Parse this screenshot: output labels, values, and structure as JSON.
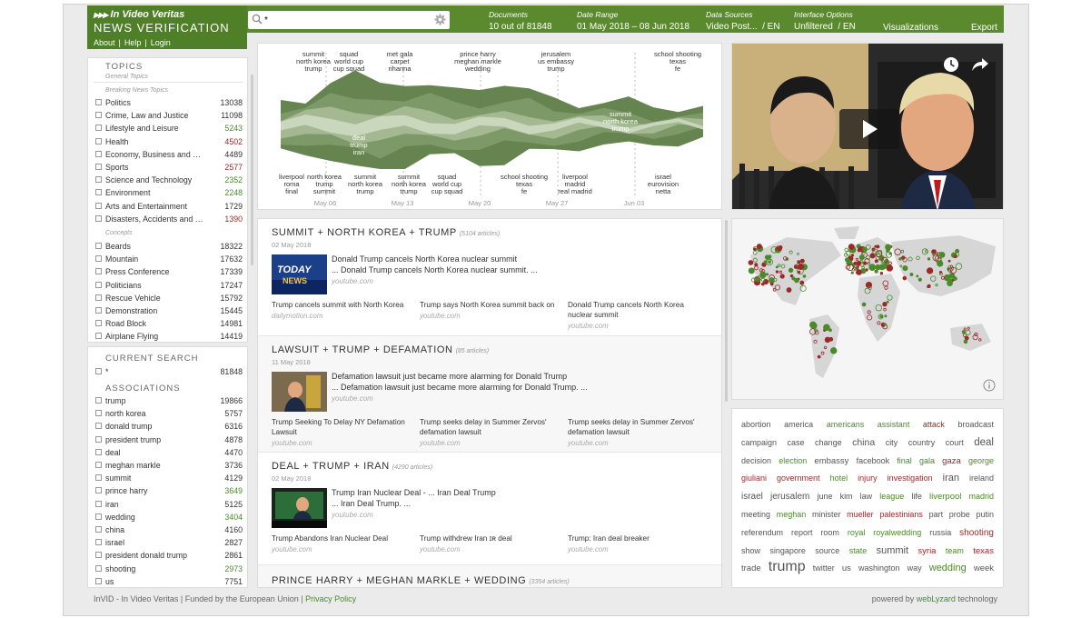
{
  "brand": {
    "line1": "In Video Veritas",
    "line2": "NEWS VERIFICATION",
    "links": [
      "About",
      "Help",
      "Login"
    ]
  },
  "search": {
    "value": "*"
  },
  "header": {
    "documents": {
      "label": "Documents",
      "value": "10 out of 81848"
    },
    "date_range": {
      "label": "Date Range",
      "value": "01 May 2018 – 08 Jun 2018"
    },
    "data_sources": {
      "label": "Data Sources",
      "value": "Video Post...",
      "lang": "/ EN"
    },
    "interface": {
      "label": "Interface Options",
      "value": "Unfiltered",
      "lang": "/ EN"
    },
    "visualizations": "Visualizations",
    "export": "Export"
  },
  "topics": {
    "title": "TOPICS",
    "general": "General Topics",
    "breaking": "Breaking News Topics",
    "items": [
      {
        "name": "Politics",
        "count": "13038",
        "c": ""
      },
      {
        "name": "Crime, Law and Justice",
        "count": "11098",
        "c": ""
      },
      {
        "name": "Lifestyle and Leisure",
        "count": "5243",
        "c": "grn"
      },
      {
        "name": "Health",
        "count": "4502",
        "c": "red"
      },
      {
        "name": "Economy, Business and Finan...",
        "count": "4489",
        "c": ""
      },
      {
        "name": "Sports",
        "count": "2577",
        "c": "red"
      },
      {
        "name": "Science and Technology",
        "count": "2352",
        "c": "grn"
      },
      {
        "name": "Environment",
        "count": "2248",
        "c": "grn"
      },
      {
        "name": "Arts and Entertainment",
        "count": "1729",
        "c": ""
      },
      {
        "name": "Disasters, Accidents and Eme...",
        "count": "1390",
        "c": "red"
      }
    ],
    "concepts_label": "Concepts",
    "concepts": [
      {
        "name": "Beards",
        "count": "18322",
        "c": ""
      },
      {
        "name": "Mountain",
        "count": "17632",
        "c": ""
      },
      {
        "name": "Press Conference",
        "count": "17339",
        "c": ""
      },
      {
        "name": "Politicians",
        "count": "17247",
        "c": ""
      },
      {
        "name": "Rescue Vehicle",
        "count": "15792",
        "c": ""
      },
      {
        "name": "Demonstration",
        "count": "15445",
        "c": ""
      },
      {
        "name": "Road Block",
        "count": "14981",
        "c": ""
      },
      {
        "name": "Airplane Flying",
        "count": "14419",
        "c": ""
      }
    ]
  },
  "current_search": {
    "title": "CURRENT SEARCH",
    "query": "*",
    "count": "81848"
  },
  "associations": {
    "title": "ASSOCIATIONS",
    "items": [
      {
        "name": "trump",
        "count": "19866",
        "c": ""
      },
      {
        "name": "north korea",
        "count": "5757",
        "c": ""
      },
      {
        "name": "donald trump",
        "count": "6316",
        "c": ""
      },
      {
        "name": "president trump",
        "count": "4878",
        "c": ""
      },
      {
        "name": "deal",
        "count": "4470",
        "c": ""
      },
      {
        "name": "meghan markle",
        "count": "3736",
        "c": ""
      },
      {
        "name": "summit",
        "count": "4129",
        "c": ""
      },
      {
        "name": "prince harry",
        "count": "3649",
        "c": "grn"
      },
      {
        "name": "iran",
        "count": "5125",
        "c": ""
      },
      {
        "name": "wedding",
        "count": "3404",
        "c": "grn"
      },
      {
        "name": "china",
        "count": "4160",
        "c": ""
      },
      {
        "name": "israel",
        "count": "2827",
        "c": ""
      },
      {
        "name": "president donald trump",
        "count": "2861",
        "c": ""
      },
      {
        "name": "shooting",
        "count": "2973",
        "c": "grn"
      },
      {
        "name": "us",
        "count": "7751",
        "c": ""
      }
    ]
  },
  "stream": {
    "top_labels": [
      {
        "text": "summit\nnorth korea\ntrump",
        "x": 345
      },
      {
        "text": "squad\nworld cup\ncup squad",
        "x": 384
      },
      {
        "text": "met gala\ncarpet\nrihanna",
        "x": 440
      },
      {
        "text": "prince harry\nmeghan markle\nwedding",
        "x": 526
      },
      {
        "text": "jerusalem\nus embassy\ntrump",
        "x": 612
      },
      {
        "text": "school shooting\ntexas\nfe",
        "x": 746
      }
    ],
    "bottom_labels": [
      {
        "text": "liverpool\nroma\nfinal",
        "x": 321
      },
      {
        "text": "north korea\ntrump\nsummit",
        "x": 357
      },
      {
        "text": "summit\nnorth korea\ntrump",
        "x": 402
      },
      {
        "text": "summit\nnorth korea\ntrump",
        "x": 450
      },
      {
        "text": "squad\nworld cup\ncup squad",
        "x": 492
      },
      {
        "text": "school shooting\ntexas\nfe",
        "x": 577
      },
      {
        "text": "liverpool\nmadrid\nreal madrid",
        "x": 633
      },
      {
        "text": "israel\neurovision\nnetta",
        "x": 730
      }
    ],
    "mid_labels": [
      {
        "text": "deal\ntrump\niran",
        "x": 395,
        "y": 148
      },
      {
        "text": "summit\nnorth korea\ntrump",
        "x": 683,
        "y": 122
      }
    ],
    "x_ticks": [
      {
        "label": "May 06",
        "x": 358
      },
      {
        "label": "May 13",
        "x": 443
      },
      {
        "label": "May 20",
        "x": 528
      },
      {
        "label": "May 27",
        "x": 613
      },
      {
        "label": "Jun 03",
        "x": 698
      }
    ]
  },
  "stories": [
    {
      "title": "SUMMIT + NORTH KOREA + TRUMP",
      "count": "(5104 articles)",
      "date": "02 May 2018",
      "main": "Donald Trump cancels North Korea nuclear summit",
      "sub": "... Donald Trump cancels North Korea nuclear summit. ...",
      "src": "youtube.com",
      "thumb": "today",
      "related": [
        {
          "t": "Trump cancels summit with North Korea",
          "s": "dailymotion.com"
        },
        {
          "t": "Trump says North Korea summit back on",
          "s": "youtube.com"
        },
        {
          "t": "Donald Trump cancels North Korea nuclear summit",
          "s": "youtube.com"
        }
      ]
    },
    {
      "title": "LAWSUIT + TRUMP + DEFAMATION",
      "count": "(85 articles)",
      "date": "11 May 2018",
      "main": "Defamation lawsuit just became more alarming for Donald Trump",
      "sub": "... Defamation lawsuit just became more alarming for Donald Trump. ...",
      "src": "youtube.com",
      "thumb": "office",
      "related": [
        {
          "t": "Trump Seeking To Delay NY Defamation Lawsuit",
          "s": "youtube.com"
        },
        {
          "t": "Trump seeks delay in Summer Zervos' defamation lawsuit",
          "s": "youtube.com"
        },
        {
          "t": "Trump seeks delay in Summer Zervos' defamation lawsuit",
          "s": "youtube.com"
        }
      ]
    },
    {
      "title": "DEAL + TRUMP + IRAN",
      "count": "(4290 articles)",
      "date": "02 May 2018",
      "main": "Trump Iran Nuclear Deal - ... Iran Deal Trump",
      "sub": "... Iran Deal Trump. ...",
      "src": "youtube.com",
      "thumb": "iran",
      "related": [
        {
          "t": "Trump Abandons Iran Nuclear Deal",
          "s": "youtube.com"
        },
        {
          "t": "Trump withdrew Iran ɪʀ deal",
          "s": "youtube.com"
        },
        {
          "t": "Trump: Iran deal breaker",
          "s": "youtube.com"
        }
      ]
    }
  ],
  "next_story": {
    "title": "PRINCE HARRY + MEGHAN MARKLE + WEDDING",
    "count": "(3354 articles)"
  },
  "wordcloud": [
    {
      "w": "abortion",
      "c": "#555",
      "s": 9
    },
    {
      "w": "america",
      "c": "#555",
      "s": 9
    },
    {
      "w": "americans",
      "c": "#4a8a2a",
      "s": 9
    },
    {
      "w": "assistant",
      "c": "#4a8a2a",
      "s": 9
    },
    {
      "w": "attack",
      "c": "#9a2a2a",
      "s": 9
    },
    {
      "w": "broadcast",
      "c": "#555",
      "s": 9
    },
    {
      "w": "campaign",
      "c": "#555",
      "s": 9
    },
    {
      "w": "case",
      "c": "#555",
      "s": 9
    },
    {
      "w": "change",
      "c": "#555",
      "s": 9
    },
    {
      "w": "china",
      "c": "#555",
      "s": 10.5
    },
    {
      "w": "city",
      "c": "#555",
      "s": 9
    },
    {
      "w": "country",
      "c": "#555",
      "s": 9
    },
    {
      "w": "court",
      "c": "#555",
      "s": 9
    },
    {
      "w": "deal",
      "c": "#555",
      "s": 11.5
    },
    {
      "w": "decision",
      "c": "#555",
      "s": 9
    },
    {
      "w": "election",
      "c": "#4a8a2a",
      "s": 9
    },
    {
      "w": "embassy",
      "c": "#555",
      "s": 9.5
    },
    {
      "w": "facebook",
      "c": "#555",
      "s": 9
    },
    {
      "w": "final",
      "c": "#4a8a2a",
      "s": 9
    },
    {
      "w": "gala",
      "c": "#4a8a2a",
      "s": 9
    },
    {
      "w": "gaza",
      "c": "#9a2a2a",
      "s": 9.5
    },
    {
      "w": "george",
      "c": "#4a8a2a",
      "s": 9
    },
    {
      "w": "giuliani",
      "c": "#9a2a2a",
      "s": 9
    },
    {
      "w": "government",
      "c": "#9a2a2a",
      "s": 9
    },
    {
      "w": "hotel",
      "c": "#4a8a2a",
      "s": 9
    },
    {
      "w": "injury",
      "c": "#9a2a2a",
      "s": 9
    },
    {
      "w": "investigation",
      "c": "#9a2a2a",
      "s": 9
    },
    {
      "w": "iran",
      "c": "#555",
      "s": 11
    },
    {
      "w": "ireland",
      "c": "#555",
      "s": 9
    },
    {
      "w": "israel",
      "c": "#555",
      "s": 10
    },
    {
      "w": "jerusalem",
      "c": "#555",
      "s": 10
    },
    {
      "w": "june",
      "c": "#555",
      "s": 9
    },
    {
      "w": "kim",
      "c": "#555",
      "s": 9
    },
    {
      "w": "law",
      "c": "#555",
      "s": 9
    },
    {
      "w": "league",
      "c": "#4a8a2a",
      "s": 9
    },
    {
      "w": "life",
      "c": "#555",
      "s": 9
    },
    {
      "w": "liverpool",
      "c": "#4a8a2a",
      "s": 9.5
    },
    {
      "w": "madrid",
      "c": "#4a8a2a",
      "s": 9
    },
    {
      "w": "meeting",
      "c": "#555",
      "s": 9
    },
    {
      "w": "meghan",
      "c": "#4a8a2a",
      "s": 9
    },
    {
      "w": "minister",
      "c": "#555",
      "s": 9
    },
    {
      "w": "mueller",
      "c": "#9a2a2a",
      "s": 9
    },
    {
      "w": "palestinians",
      "c": "#9a2a2a",
      "s": 9
    },
    {
      "w": "part",
      "c": "#555",
      "s": 9
    },
    {
      "w": "probe",
      "c": "#555",
      "s": 9
    },
    {
      "w": "putin",
      "c": "#555",
      "s": 9
    },
    {
      "w": "referendum",
      "c": "#555",
      "s": 9
    },
    {
      "w": "report",
      "c": "#555",
      "s": 9
    },
    {
      "w": "room",
      "c": "#555",
      "s": 9
    },
    {
      "w": "royal",
      "c": "#4a8a2a",
      "s": 9
    },
    {
      "w": "royalwedding",
      "c": "#4a8a2a",
      "s": 9
    },
    {
      "w": "russia",
      "c": "#555",
      "s": 9
    },
    {
      "w": "shooting",
      "c": "#9a2a2a",
      "s": 10
    },
    {
      "w": "show",
      "c": "#555",
      "s": 9
    },
    {
      "w": "singapore",
      "c": "#555",
      "s": 9
    },
    {
      "w": "source",
      "c": "#555",
      "s": 9
    },
    {
      "w": "state",
      "c": "#4a8a2a",
      "s": 9
    },
    {
      "w": "summit",
      "c": "#555",
      "s": 11
    },
    {
      "w": "syria",
      "c": "#9a2a2a",
      "s": 9.5
    },
    {
      "w": "team",
      "c": "#4a8a2a",
      "s": 9
    },
    {
      "w": "texas",
      "c": "#9a2a2a",
      "s": 9.5
    },
    {
      "w": "trade",
      "c": "#555",
      "s": 9.5
    },
    {
      "w": "trump",
      "c": "#555",
      "s": 16
    },
    {
      "w": "twitter",
      "c": "#555",
      "s": 9
    },
    {
      "w": "us",
      "c": "#555",
      "s": 9.5
    },
    {
      "w": "washington",
      "c": "#555",
      "s": 9
    },
    {
      "w": "way",
      "c": "#555",
      "s": 9
    },
    {
      "w": "wedding",
      "c": "#4a8a2a",
      "s": 11
    },
    {
      "w": "week",
      "c": "#555",
      "s": 9.5
    }
  ],
  "footer": {
    "left_text": "InVID - In Video Veritas | Funded by the European Union |",
    "privacy": "Privacy Policy",
    "right_pre": "powered by",
    "right_brand": "webLyzard",
    "right_post": "technology"
  },
  "colors": {
    "brand_green": "#5a8a2d",
    "dark_green": "#4f7f26",
    "red": "#9a2a2a",
    "green": "#4a8a2a"
  }
}
